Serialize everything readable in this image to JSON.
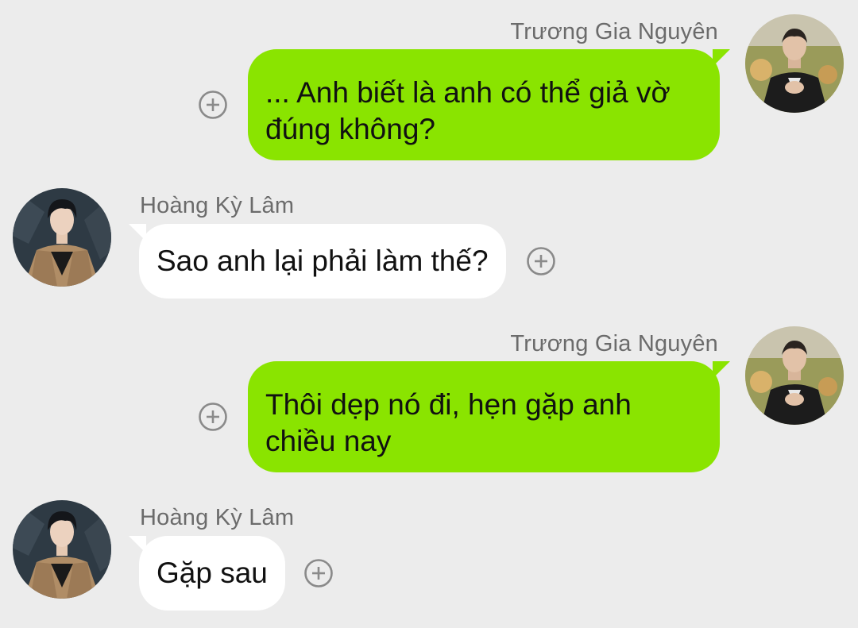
{
  "messages": [
    {
      "direction": "outgoing",
      "sender": "Trương Gia Nguyên",
      "text": "... Anh biết là anh có thể giả vờ đúng không?"
    },
    {
      "direction": "incoming",
      "sender": "Hoàng Kỳ Lâm",
      "text": "Sao anh lại phải làm thế?"
    },
    {
      "direction": "outgoing",
      "sender": "Trương Gia Nguyên",
      "text": "Thôi dẹp nó đi, hẹn gặp anh chiều nay"
    },
    {
      "direction": "incoming",
      "sender": "Hoàng Kỳ Lâm",
      "text": "Gặp sau"
    }
  ],
  "icons": {
    "react_button": "plus-circle-icon",
    "avatar_outgoing": "avatar-truong-gia-nguyen",
    "avatar_incoming": "avatar-hoang-ky-lam"
  },
  "colors": {
    "background": "#ececec",
    "outgoing_bubble": "#8ae400",
    "incoming_bubble": "#ffffff",
    "sender_name": "#6b6b6b",
    "message_text": "#111111",
    "plus_icon": "#8a8a8a"
  }
}
